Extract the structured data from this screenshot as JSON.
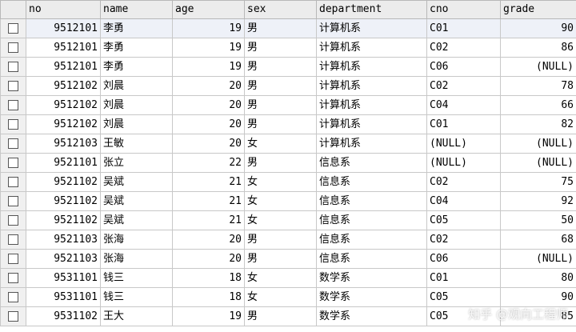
{
  "columns": [
    "no",
    "name",
    "age",
    "sex",
    "department",
    "cno",
    "grade"
  ],
  "rows": [
    [
      "9512101",
      "李勇",
      "19",
      "男",
      "计算机系",
      "C01",
      "90"
    ],
    [
      "9512101",
      "李勇",
      "19",
      "男",
      "计算机系",
      "C02",
      "86"
    ],
    [
      "9512101",
      "李勇",
      "19",
      "男",
      "计算机系",
      "C06",
      "(NULL)"
    ],
    [
      "9512102",
      "刘晨",
      "20",
      "男",
      "计算机系",
      "C02",
      "78"
    ],
    [
      "9512102",
      "刘晨",
      "20",
      "男",
      "计算机系",
      "C04",
      "66"
    ],
    [
      "9512102",
      "刘晨",
      "20",
      "男",
      "计算机系",
      "C01",
      "82"
    ],
    [
      "9512103",
      "王敏",
      "20",
      "女",
      "计算机系",
      "(NULL)",
      "(NULL)"
    ],
    [
      "9521101",
      "张立",
      "22",
      "男",
      "信息系",
      "(NULL)",
      "(NULL)"
    ],
    [
      "9521102",
      "吴斌",
      "21",
      "女",
      "信息系",
      "C02",
      "75"
    ],
    [
      "9521102",
      "吴斌",
      "21",
      "女",
      "信息系",
      "C04",
      "92"
    ],
    [
      "9521102",
      "吴斌",
      "21",
      "女",
      "信息系",
      "C05",
      "50"
    ],
    [
      "9521103",
      "张海",
      "20",
      "男",
      "信息系",
      "C02",
      "68"
    ],
    [
      "9521103",
      "张海",
      "20",
      "男",
      "信息系",
      "C06",
      "(NULL)"
    ],
    [
      "9531101",
      "钱三",
      "18",
      "女",
      "数学系",
      "C01",
      "80"
    ],
    [
      "9531101",
      "钱三",
      "18",
      "女",
      "数学系",
      "C05",
      "90"
    ],
    [
      "9531102",
      "王大",
      "19",
      "男",
      "数学系",
      "C05",
      "85"
    ]
  ],
  "watermark": "知乎 @观向工程师"
}
